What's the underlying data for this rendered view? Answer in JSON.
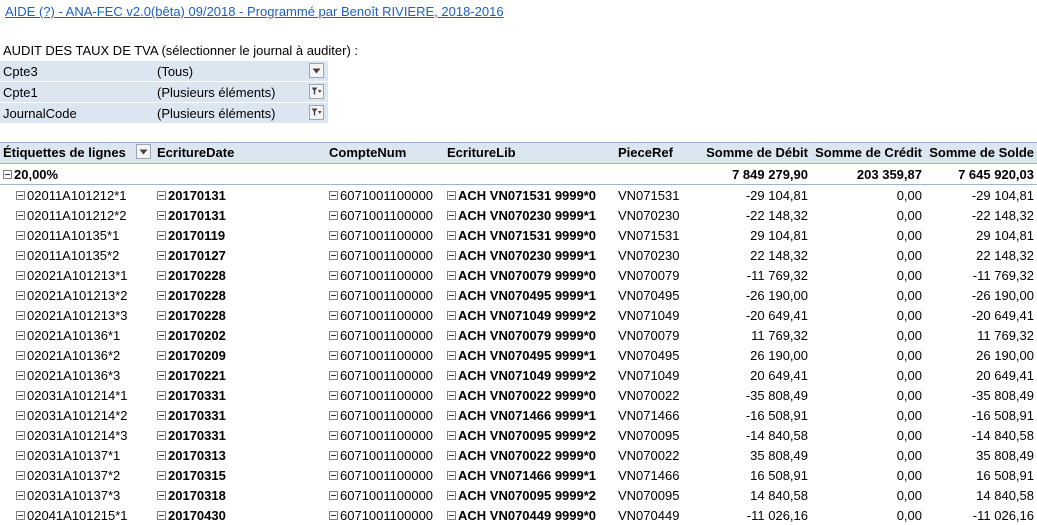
{
  "header_link": "AIDE (?) - ANA-FEC v2.0(bêta) 09/2018 - Programmé par Benoît RIVIERE, 2018-2016",
  "audit_title": "AUDIT DES TAUX DE TVA (sélectionner le journal à auditer) :",
  "filters": [
    {
      "label": "Cpte3",
      "value": "(Tous)",
      "icon": "dropdown-arrow-icon"
    },
    {
      "label": "Cpte1",
      "value": "(Plusieurs éléments)",
      "icon": "filter-funnel-icon"
    },
    {
      "label": "JournalCode",
      "value": "(Plusieurs éléments)",
      "icon": "filter-funnel-icon"
    }
  ],
  "columns": {
    "etiquettes": "Étiquettes de lignes",
    "date": "EcritureDate",
    "compte": "CompteNum",
    "lib": "EcritureLib",
    "piece": "PieceRef",
    "debit": "Somme de Débit",
    "credit": "Somme de Crédit",
    "solde": "Somme de Solde"
  },
  "group": {
    "label": "20,00%",
    "debit": "7 849 279,90",
    "credit": "203 359,87",
    "solde": "7 645 920,03"
  },
  "rows": [
    {
      "etq": "02011A101212*1",
      "date": "20170131",
      "compte": "6071001100000",
      "lib": "ACH VN071531 9999*0",
      "piece": "VN071531",
      "debit": "-29 104,81",
      "credit": "0,00",
      "solde": "-29 104,81"
    },
    {
      "etq": "02011A101212*2",
      "date": "20170131",
      "compte": "6071001100000",
      "lib": "ACH VN070230 9999*1",
      "piece": "VN070230",
      "debit": "-22 148,32",
      "credit": "0,00",
      "solde": "-22 148,32"
    },
    {
      "etq": "02011A10135*1",
      "date": "20170119",
      "compte": "6071001100000",
      "lib": "ACH VN071531 9999*0",
      "piece": "VN071531",
      "debit": "29 104,81",
      "credit": "0,00",
      "solde": "29 104,81"
    },
    {
      "etq": "02011A10135*2",
      "date": "20170127",
      "compte": "6071001100000",
      "lib": "ACH VN070230 9999*1",
      "piece": "VN070230",
      "debit": "22 148,32",
      "credit": "0,00",
      "solde": "22 148,32"
    },
    {
      "etq": "02021A101213*1",
      "date": "20170228",
      "compte": "6071001100000",
      "lib": "ACH VN070079 9999*0",
      "piece": "VN070079",
      "debit": "-11 769,32",
      "credit": "0,00",
      "solde": "-11 769,32"
    },
    {
      "etq": "02021A101213*2",
      "date": "20170228",
      "compte": "6071001100000",
      "lib": "ACH VN070495 9999*1",
      "piece": "VN070495",
      "debit": "-26 190,00",
      "credit": "0,00",
      "solde": "-26 190,00"
    },
    {
      "etq": "02021A101213*3",
      "date": "20170228",
      "compte": "6071001100000",
      "lib": "ACH VN071049 9999*2",
      "piece": "VN071049",
      "debit": "-20 649,41",
      "credit": "0,00",
      "solde": "-20 649,41"
    },
    {
      "etq": "02021A10136*1",
      "date": "20170202",
      "compte": "6071001100000",
      "lib": "ACH VN070079 9999*0",
      "piece": "VN070079",
      "debit": "11 769,32",
      "credit": "0,00",
      "solde": "11 769,32"
    },
    {
      "etq": "02021A10136*2",
      "date": "20170209",
      "compte": "6071001100000",
      "lib": "ACH VN070495 9999*1",
      "piece": "VN070495",
      "debit": "26 190,00",
      "credit": "0,00",
      "solde": "26 190,00"
    },
    {
      "etq": "02021A10136*3",
      "date": "20170221",
      "compte": "6071001100000",
      "lib": "ACH VN071049 9999*2",
      "piece": "VN071049",
      "debit": "20 649,41",
      "credit": "0,00",
      "solde": "20 649,41"
    },
    {
      "etq": "02031A101214*1",
      "date": "20170331",
      "compte": "6071001100000",
      "lib": "ACH VN070022 9999*0",
      "piece": "VN070022",
      "debit": "-35 808,49",
      "credit": "0,00",
      "solde": "-35 808,49"
    },
    {
      "etq": "02031A101214*2",
      "date": "20170331",
      "compte": "6071001100000",
      "lib": "ACH VN071466 9999*1",
      "piece": "VN071466",
      "debit": "-16 508,91",
      "credit": "0,00",
      "solde": "-16 508,91"
    },
    {
      "etq": "02031A101214*3",
      "date": "20170331",
      "compte": "6071001100000",
      "lib": "ACH VN070095 9999*2",
      "piece": "VN070095",
      "debit": "-14 840,58",
      "credit": "0,00",
      "solde": "-14 840,58"
    },
    {
      "etq": "02031A10137*1",
      "date": "20170313",
      "compte": "6071001100000",
      "lib": "ACH VN070022 9999*0",
      "piece": "VN070022",
      "debit": "35 808,49",
      "credit": "0,00",
      "solde": "35 808,49"
    },
    {
      "etq": "02031A10137*2",
      "date": "20170315",
      "compte": "6071001100000",
      "lib": "ACH VN071466 9999*1",
      "piece": "VN071466",
      "debit": "16 508,91",
      "credit": "0,00",
      "solde": "16 508,91"
    },
    {
      "etq": "02031A10137*3",
      "date": "20170318",
      "compte": "6071001100000",
      "lib": "ACH VN070095 9999*2",
      "piece": "VN070095",
      "debit": "14 840,58",
      "credit": "0,00",
      "solde": "14 840,58"
    },
    {
      "etq": "02041A101215*1",
      "date": "20170430",
      "compte": "6071001100000",
      "lib": "ACH VN070449 9999*0",
      "piece": "VN070449",
      "debit": "-11 026,16",
      "credit": "0,00",
      "solde": "-11 026,16"
    }
  ]
}
